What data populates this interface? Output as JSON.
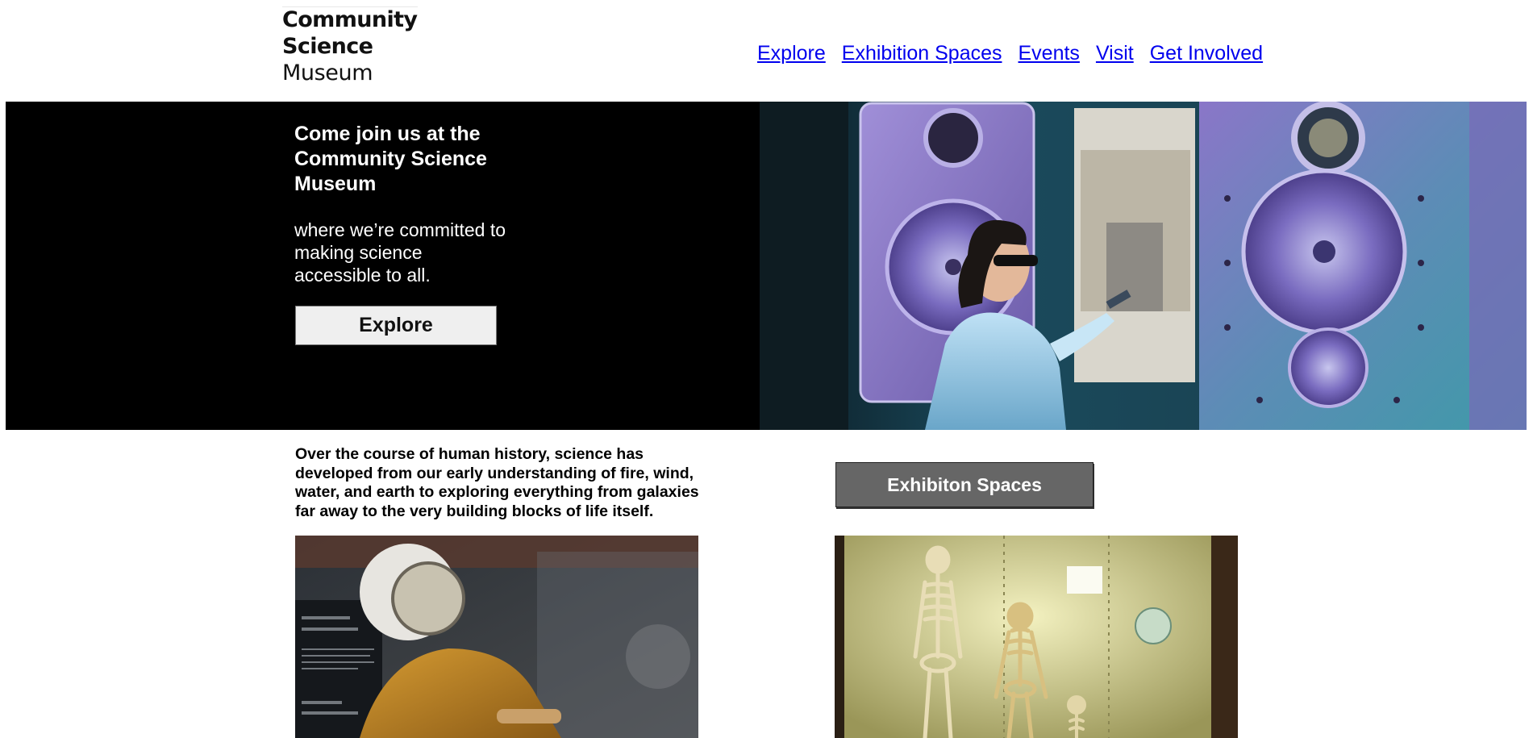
{
  "logo": {
    "line1": "Community",
    "line2": "Science",
    "line3": "Museum"
  },
  "nav": {
    "items": [
      {
        "label": "Explore"
      },
      {
        "label": "Exhibition Spaces"
      },
      {
        "label": "Events"
      },
      {
        "label": "Visit"
      },
      {
        "label": "Get Involved"
      }
    ]
  },
  "hero": {
    "title": "Come join us at the Community Science Museum",
    "subtitle": "where we’re committed to making science accessible to all.",
    "button_label": "Explore"
  },
  "intro": {
    "text": "Over the course of human history, science has developed from our early understanding of fire, wind, water, and earth to exploring everything from galaxies far away to the very building blocks of life itself."
  },
  "exhibits": {
    "button_label": "Exhibiton Spaces"
  },
  "colors": {
    "link": "#0000ee",
    "hero_bg": "#000000",
    "exhibit_button_bg": "#666666"
  }
}
